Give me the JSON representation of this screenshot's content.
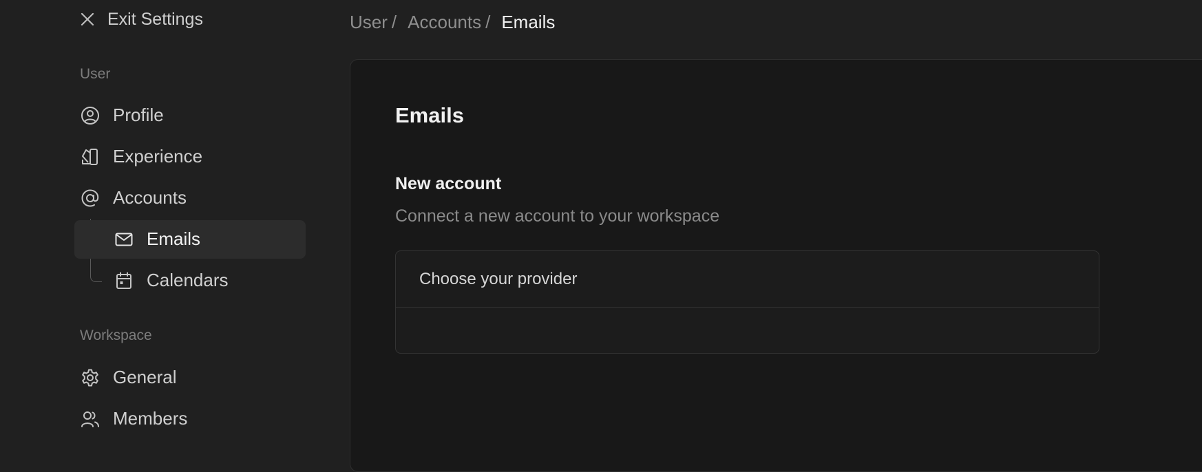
{
  "sidebar": {
    "exit_label": "Exit Settings",
    "sections": {
      "user": "User",
      "workspace": "Workspace"
    },
    "items": {
      "profile": "Profile",
      "experience": "Experience",
      "accounts": "Accounts",
      "emails": "Emails",
      "calendars": "Calendars",
      "general": "General",
      "members": "Members"
    },
    "active_item": "Emails"
  },
  "breadcrumb": {
    "items": [
      "User",
      "Accounts",
      "Emails"
    ],
    "separator": "/"
  },
  "main": {
    "title": "Emails",
    "section_title": "New account",
    "section_description": "Connect a new account to your workspace",
    "provider_label": "Choose your provider"
  },
  "colors": {
    "background": "#202020",
    "panel": "#181818",
    "active_item_bg": "#2c2c2c",
    "muted_text": "#8a8a8a"
  }
}
